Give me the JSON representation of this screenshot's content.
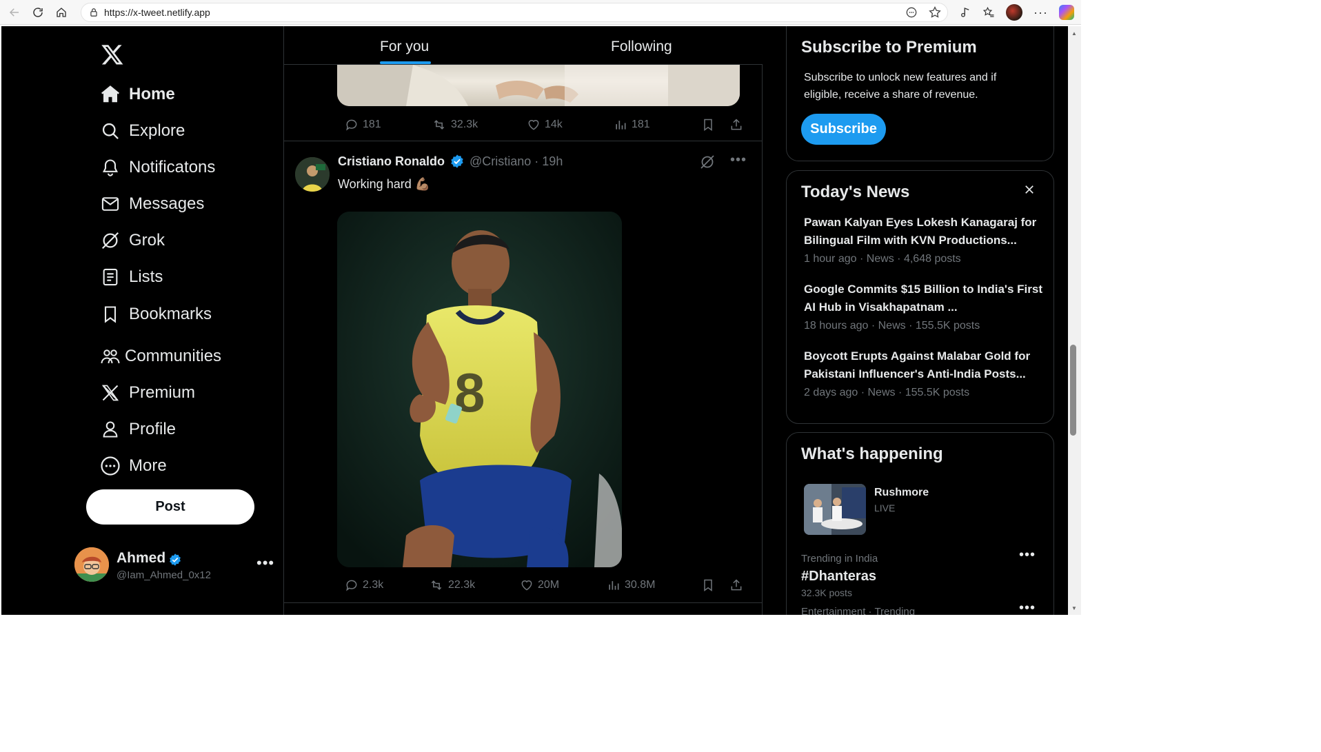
{
  "browser": {
    "url": "https://x-tweet.netlify.app"
  },
  "sidebar": {
    "nav": [
      {
        "label": "Home",
        "icon": "home-icon"
      },
      {
        "label": "Explore",
        "icon": "search-icon"
      },
      {
        "label": "Notificatons",
        "icon": "bell-icon"
      },
      {
        "label": "Messages",
        "icon": "mail-icon"
      },
      {
        "label": "Grok",
        "icon": "grok-icon"
      },
      {
        "label": "Lists",
        "icon": "list-icon"
      },
      {
        "label": "Bookmarks",
        "icon": "bookmark-icon"
      },
      {
        "label": "Communities",
        "icon": "communities-icon"
      },
      {
        "label": "Premium",
        "icon": "x-logo-icon"
      },
      {
        "label": "Profile",
        "icon": "person-icon"
      },
      {
        "label": "More",
        "icon": "more-circle-icon"
      }
    ],
    "post_label": "Post",
    "account": {
      "name": "Ahmed",
      "handle": "@Iam_Ahmed_0x12"
    }
  },
  "feed": {
    "tabs": [
      "For you",
      "Following"
    ],
    "active_tab": "For you",
    "prev_tweet_actions": {
      "replies": "181",
      "reposts": "32.3k",
      "likes": "14k",
      "views": "181"
    },
    "tweet": {
      "author": "Cristiano Ronaldo",
      "handle": "@Cristiano",
      "time": "19h",
      "meta": "@Cristiano · 19h",
      "text": "Working hard 💪🏽",
      "actions": {
        "replies": "2.3k",
        "reposts": "22.3k",
        "likes": "20M",
        "views": "30.8M"
      }
    }
  },
  "right": {
    "premium": {
      "title": "Subscribe to Premium",
      "description": "Subscribe to unlock new features and if eligible, receive a share of revenue.",
      "button": "Subscribe"
    },
    "news": {
      "title": "Today's News",
      "items": [
        {
          "headline": "Pawan Kalyan Eyes Lokesh Kanagaraj for Bilingual Film with KVN Productions...",
          "meta": "1 hour ago · News · 4,648 posts"
        },
        {
          "headline": "Google Commits $15 Billion to India's First AI Hub in Visakhapatnam ...",
          "meta": "18 hours ago · News · 155.5K posts"
        },
        {
          "headline": "Boycott Erupts Against Malabar Gold for Pakistani Influencer's Anti-India Posts...",
          "meta": "2 days ago · News · 155.5K posts"
        }
      ]
    },
    "happening": {
      "title": "What's happening",
      "live": {
        "title": "Rushmore",
        "status": "LIVE"
      },
      "trends": [
        {
          "context": "Trending in India",
          "name": "#Dhanteras",
          "count": "32.3K posts"
        },
        {
          "context": "Entertainment · Trending",
          "name": "",
          "count": ""
        }
      ]
    }
  },
  "colors": {
    "accent": "#1d9bf0",
    "background": "#000000",
    "text": "#e7e9ea",
    "muted": "#71767b"
  }
}
